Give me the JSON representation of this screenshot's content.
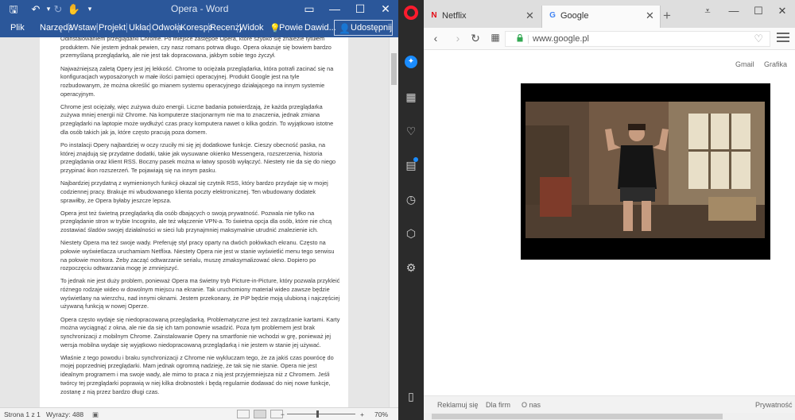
{
  "word": {
    "title": "Opera - Word",
    "ribbon_tabs": [
      "Plik",
      "Narzędz",
      "Wstawi",
      "Projekt",
      "Układ",
      "Odwoła",
      "Korespc",
      "Recenzj",
      "Widok",
      "Powie",
      "Dawid..."
    ],
    "share_label": "Udostępnij",
    "paragraphs": [
      "Odinstalowaniem przeglądarki Chrome. Po miejsce zastępoe Opera, które szybko się znalezie tytułem produktem. Nie jestem jednak pewien, czy nasz romans potrwa długo. Opera okazuje się bowiem bardzo przemyślaną przeglądarką, ale nie jest tak dopracowana, jakbym sobie tego życzył.",
      "Najważniejszą zaletą Opery jest jej lekkość. Chrome to ociężała przeglądarka, która potrafi zacinać się na konfiguracjach wyposażonych w małe ilości pamięci operacyjnej. Produkt Google jest na tyle rozbudowanym, że można określić go mianem systemu operacyjnego działającego na innym systemie operacyjnym.",
      "Chrome jest ociężały, więc zużywa dużo energii. Liczne badania potwierdzają, że każda przeglądarka zużywa mniej energii niż Chrome. Na komputerze stacjonarnym nie ma to znaczenia, jednak zmiana przeglądarki na laptopie może wydłużyć czas pracy komputera nawet o kilka godzin. To wyjątkowo istotne dla osób takich jak ja, które często pracują poza domem.",
      "Po instalacji Opery najbardziej w oczy rzuciły mi się jej dodatkowe funkcje. Cieszy obecność paska, na której znajdują się przydatne dodatki, takie jak wysuwane okienko Messengera, rozszerzenia, historia przeglądania oraz klient RSS. Boczny pasek można w łatwy sposób wyłączyć. Niestety nie da się do niego przypinać ikon rozszerzeń. Te pojawiają się na innym pasku.",
      "Najbardziej przydatną z wymienionych funkcji okazał się czytnik RSS, który bardzo przydaje się w mojej codziennej pracy. Brakuje mi wbudowanego klienta poczty elektronicznej. Ten wbudowany dodatek sprawiłby, że Opera byłaby jeszcze lepsza.",
      "Opera jest też świetną przeglądarką dla osób dbających o swoją prywatność. Pozwala nie tylko na przeglądanie stron w trybie Incognito, ale też włączenie VPN-a. To świetna opcja dla osób, które nie chcą zostawiać śladów swojej działalności w sieci lub przynajmniej maksymalnie utrudnić znalezienie ich.",
      "Niestety Opera ma też swoje wady. Preferuję styl pracy oparty na dwóch połówkach ekranu. Często na połowie wyświetlacza uruchamiam Netflixa. Niestety Opera nie jest w stanie wyświetlić menu tego serwisu na połowie monitora. Żeby zacząć odtwarzanie serialu, muszę zmaksymalizować okno. Dopiero po rozpoczęciu odtwarzania mogę je zmniejszyć.",
      "To jednak nie jest duży problem, ponieważ Opera ma świetny tryb Picture-in-Picture, który pozwala przykleić różnego rodzaje wideo w dowolnym miejscu na ekranie. Tak uruchomiony materiał wideo zawsze będzie wyświetlany na wierzchu, nad innymi oknami. Jestem przekonany, że PiP będzie moją ulubioną i najczęściej używaną funkcją w nowej Operze.",
      "Opera często wydaje się niedopracowaną przeglądarką. Problematyczne jest też zarządzanie kartami. Karty można wyciągnąć z okna, ale nie da się ich tam ponownie wsadzić. Poza tym problemem jest brak synchronizacji z mobilnym Chrome. Zainstalowanie Opery na smartfonie nie wchodzi w grę, ponieważ jej wersja mobilna wydaje się wyjątkowo niedopracowaną przeglądarką i nie jestem w stanie jej używać.",
      "Właśnie z tego powodu i braku synchronizacji z Chrome nie wykluczam tego, że za jakiś czas powrócę do mojej poprzedniej przeglądarki. Mam jednak ogromną nadzieję, że tak się nie stanie. Opera nie jest idealnym programem i ma swoje wady, ale mimo to praca z nią jest przyjemniejsza niż z Chromem. Jeśli twórcy tej przeglądarki poprawią w niej kilka drobnostek i będą regularnie dodawać do niej nowe funkcje, zostanę z nią przez bardzo długi czas."
    ],
    "status": {
      "page": "Strona 1 z 1",
      "words": "Wyrazy: 488",
      "zoom": "70%"
    }
  },
  "browser": {
    "tabs": [
      {
        "icon": "N",
        "label": "Netflix",
        "color": "#e50914"
      },
      {
        "icon": "G",
        "label": "Google",
        "color": "#4285f4"
      }
    ],
    "url": "www.google.pl",
    "google_links": [
      "Gmail",
      "Grafika"
    ],
    "footer_left": [
      "Reklamuj się",
      "Dla firm",
      "O nas"
    ],
    "footer_right": "Prywatność"
  },
  "colors": {
    "word_blue": "#2b579a",
    "opera_red": "#ff1b2d",
    "opera_sidebar": "#2b2b2b",
    "secure_green": "#33a853"
  }
}
